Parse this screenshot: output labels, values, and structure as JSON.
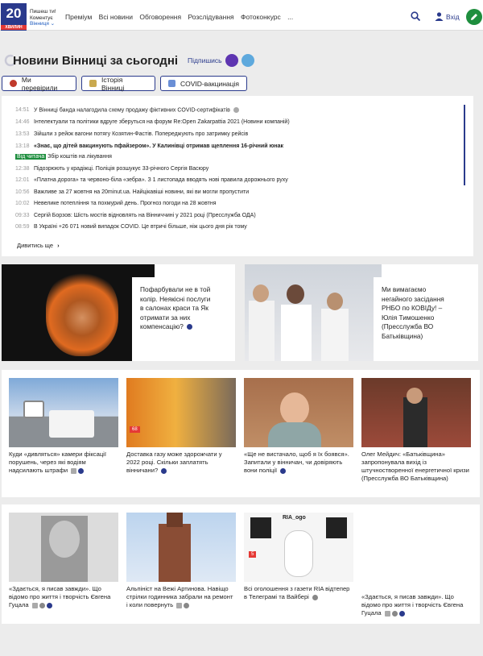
{
  "header": {
    "logo_text": "20",
    "logo_sub": "ХВИЛИН",
    "tagline": [
      "Пишеш ти!",
      "Коментує",
      "Вінниця ⌄"
    ],
    "nav": [
      "Преміум",
      "Всі новини",
      "Обговорення",
      "Розслідування",
      "Фотоконкурс",
      "..."
    ],
    "login_label": "Вхід"
  },
  "page": {
    "title": "Новини Вінниці за сьогодні",
    "subscribe_label": "Підпишись"
  },
  "chips": [
    "Ми перевірили",
    "Історія Вінниці",
    "COVID-вакцинація"
  ],
  "news": [
    {
      "time": "14:51",
      "text": "У Вінниці банда налагодила схему продажу фіктивних COVID-сертифікатів"
    },
    {
      "time": "14:46",
      "text": "Інтелектуали та політики вдруге зберуться на форум Re:Open Zakarpattia 2021 (Новини компаній)"
    },
    {
      "time": "13:53",
      "text": "Зійшли з рейок вагони потягу Козятин-Фастів. Попереджують про затримку рейсів"
    },
    {
      "time": "13:18",
      "text": "«Знає, що дітей вакцинують пфайзером». У Калинівці отримав щеплення 16-річний юнак"
    },
    {
      "badge": "Від читача",
      "text": "Збір коштів на лікування"
    },
    {
      "time": "12:38",
      "text": "Підозрюють у крадіжці. Поліція розшукує 33-річного Сергія Васюру"
    },
    {
      "time": "12:01",
      "text": "«Платна дорога» та червоно-біла «зебра». З 1 листопада вводять нові правила дорожнього руху"
    },
    {
      "time": "10:56",
      "text": "Важливе за 27 жовтня на 20minut.ua. Найцікавіші новини, які ви могли пропустити"
    },
    {
      "time": "10:02",
      "text": "Невелике потепління та похмурий день. Прогноз погоди на 28 жовтня"
    },
    {
      "time": "09:33",
      "text": "Сергій Борзов: Шість мостів відновлять на Вінниччині у 2021 році (Пресслужба ОДА)"
    },
    {
      "time": "08:59",
      "text": "В Україні +26 071 новий випадок COVID. Це втричі більше, ніж цього дня рік тому"
    }
  ],
  "more_label": "Дивитись ще",
  "featured": [
    "Пофарбували не в той колір. Неякісні послуги в салонах краси та Як отримати за них компенсацію?",
    "Ми вимагаємо негайного засідання РНБО по КОВІДу! – Юлія Тимошенко (Пресслужба ВО Батьківщина)"
  ],
  "row1": [
    "Куди «дивляться» камери фіксації порушень, через які водіям надсилають штрафи",
    "Доставка газу може здорожчати у 2022 році. Скільки заплатять вінничани?",
    "«Ще не вистачало, щоб я їх боявся». Запитали у вінничан, чи довіряють вони поліції",
    "Олег Мейдич: «Батьківщина» запропонувала вихід із штучностворенної енергетичної кризи (Пресслужба ВО Батьківщина)"
  ],
  "row2": [
    "«Здається, я писав завжди». Що відомо про життя і творчість Євгена Гуцала",
    "Альпініст на Вежі Артинова. Навіщо стрілки годинника забрали на ремонт і коли повернуть",
    "Всі оголошення з газети RIA відтепер в Телеграмі та Вайбері",
    "«Здається, я писав завжди». Що відомо про життя і творчість Євгена Гуцала"
  ],
  "ria_label": "RIA_ogo",
  "img_badge": "68",
  "img_badge2": "5"
}
